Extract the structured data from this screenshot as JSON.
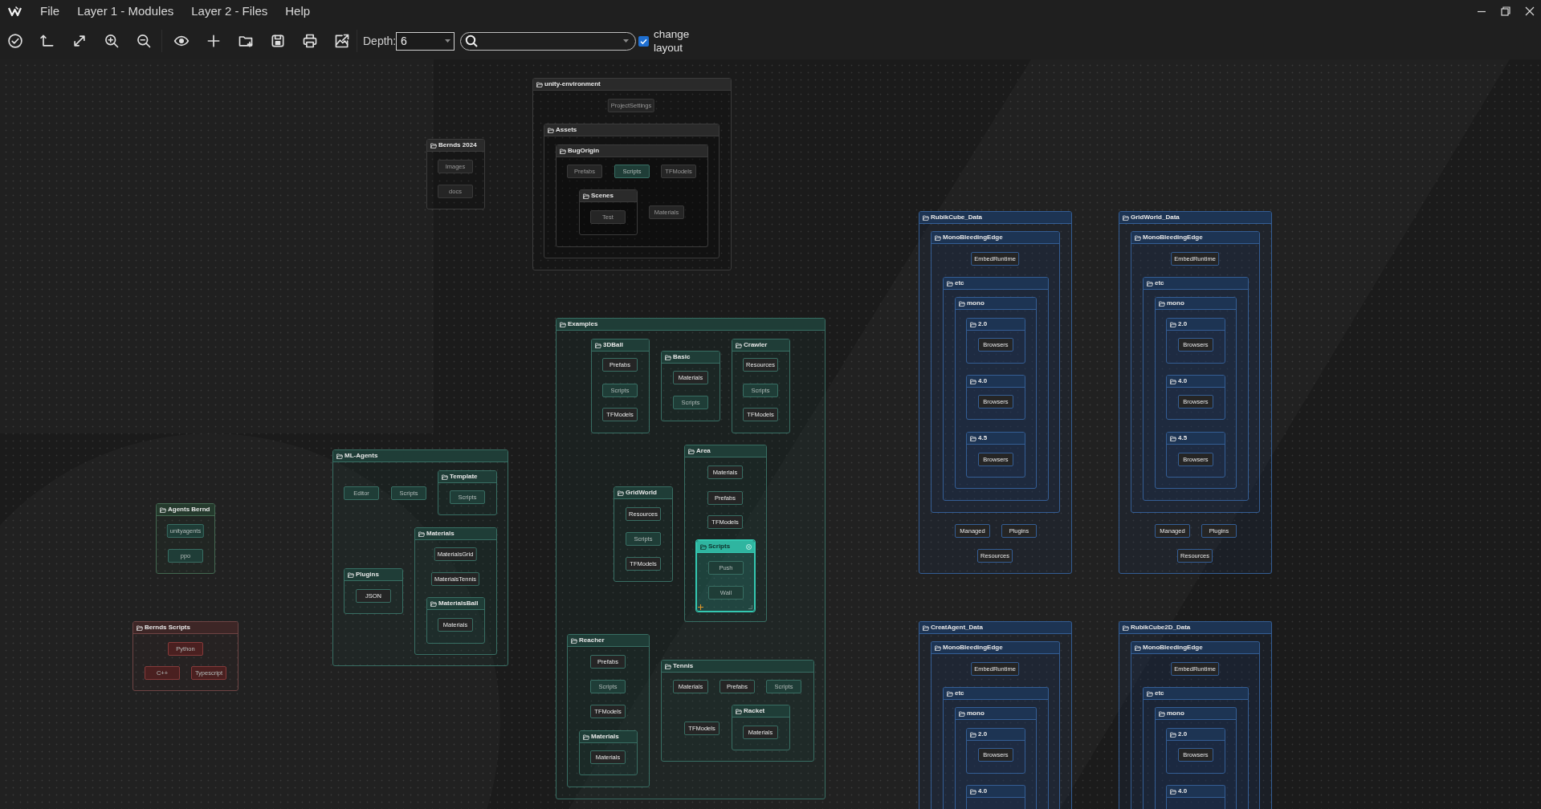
{
  "menu": [
    "File",
    "Layer 1 - Modules",
    "Layer 2 - Files",
    "Help"
  ],
  "toolbar": {
    "depth_label": "Depth:",
    "depth_value": "6",
    "change_layout": {
      "label": "change layout",
      "checked": true
    }
  },
  "diagram": {
    "nodes": [
      {
        "kind": "folder",
        "name": "Bernds 2024",
        "selected": false,
        "children": [
          {
            "kind": "file",
            "name": "Images",
            "selected": false
          },
          {
            "kind": "file",
            "name": "docs",
            "selected": false
          }
        ]
      },
      {
        "kind": "folder",
        "name": "unity-environment",
        "selected": false,
        "children": [
          {
            "kind": "file",
            "name": "ProjectSettings",
            "selected": false
          },
          {
            "kind": "folder",
            "name": "Assets",
            "selected": false,
            "children": [
              {
                "kind": "folder",
                "name": "BugOrigin",
                "selected": false,
                "children": [
                  {
                    "kind": "file",
                    "name": "Prefabs",
                    "selected": false
                  },
                  {
                    "kind": "file",
                    "name": "Scripts",
                    "color": "#1f3d37",
                    "selected": false
                  },
                  {
                    "kind": "file",
                    "name": "TFModels",
                    "selected": false
                  },
                  {
                    "kind": "folder",
                    "name": "Scenes",
                    "selected": false,
                    "children": [
                      {
                        "kind": "file",
                        "name": "Test",
                        "selected": false
                      }
                    ]
                  },
                  {
                    "kind": "file",
                    "name": "Materials",
                    "selected": false
                  }
                ]
              }
            ]
          }
        ]
      },
      {
        "kind": "folder",
        "name": "Agents Bernd",
        "color": "#253a2d",
        "selected": false,
        "children": [
          {
            "kind": "file",
            "name": "unityagents",
            "color": "#1f3d37",
            "selected": false
          },
          {
            "kind": "file",
            "name": "ppo",
            "color": "#1f3d37",
            "selected": false
          }
        ]
      },
      {
        "kind": "folder",
        "name": "Bernds Scripts",
        "color": "#3d2626",
        "selected": false,
        "children": [
          {
            "kind": "file",
            "name": "Python",
            "color": "#4a2020",
            "selected": false
          },
          {
            "kind": "file",
            "name": "C++",
            "color": "#4a2020",
            "selected": false
          },
          {
            "kind": "file",
            "name": "Typescript",
            "color": "#4a2020",
            "selected": false
          }
        ]
      },
      {
        "kind": "folder",
        "name": "ML-Agents",
        "color": "#1f3d37",
        "selected": false,
        "children": [
          {
            "kind": "file",
            "name": "Editor",
            "color": "#1f3d37",
            "selected": false
          },
          {
            "kind": "file",
            "name": "Scripts",
            "color": "#1f3d37",
            "selected": false
          },
          {
            "kind": "folder",
            "name": "Template",
            "color": "#1f3d37",
            "selected": false,
            "children": [
              {
                "kind": "file",
                "name": "Scripts",
                "color": "#1f3d37",
                "selected": false
              }
            ]
          },
          {
            "kind": "folder",
            "name": "Plugins",
            "selected": false,
            "children": [
              {
                "kind": "file",
                "name": "JSON",
                "selected": false
              }
            ]
          },
          {
            "kind": "folder",
            "name": "Materials",
            "selected": false,
            "children": [
              {
                "kind": "file",
                "name": "MaterialsGrid",
                "selected": false
              },
              {
                "kind": "file",
                "name": "MaterialsTennis",
                "selected": false
              },
              {
                "kind": "folder",
                "name": "MaterialsBall",
                "selected": false,
                "children": [
                  {
                    "kind": "file",
                    "name": "Materials",
                    "selected": false
                  }
                ]
              }
            ]
          }
        ]
      },
      {
        "kind": "folder",
        "name": "Examples",
        "color": "#1f3d37",
        "selected": false,
        "children": [
          {
            "kind": "folder",
            "name": "3DBall",
            "selected": false,
            "children": [
              {
                "kind": "file",
                "name": "Prefabs",
                "selected": false
              },
              {
                "kind": "file",
                "name": "Scripts",
                "color": "#1f3d37",
                "selected": false
              },
              {
                "kind": "file",
                "name": "TFModels",
                "selected": false
              }
            ]
          },
          {
            "kind": "folder",
            "name": "Basic",
            "color": "#1f3d37",
            "selected": false,
            "children": [
              {
                "kind": "file",
                "name": "Materials",
                "selected": false
              },
              {
                "kind": "file",
                "name": "Scripts",
                "color": "#1f3d37",
                "selected": false
              }
            ]
          },
          {
            "kind": "folder",
            "name": "Crawler",
            "selected": false,
            "children": [
              {
                "kind": "file",
                "name": "Resources",
                "selected": false
              },
              {
                "kind": "file",
                "name": "Scripts",
                "color": "#1f3d37",
                "selected": false
              },
              {
                "kind": "file",
                "name": "TFModels",
                "selected": false
              }
            ]
          },
          {
            "kind": "folder",
            "name": "GridWorld",
            "selected": false,
            "children": [
              {
                "kind": "file",
                "name": "Resources",
                "selected": false
              },
              {
                "kind": "file",
                "name": "Scripts",
                "color": "#1f3d37",
                "selected": false
              },
              {
                "kind": "file",
                "name": "TFModels",
                "selected": false
              }
            ]
          },
          {
            "kind": "folder",
            "name": "Area",
            "selected": false,
            "children": [
              {
                "kind": "file",
                "name": "Materials",
                "selected": false
              },
              {
                "kind": "file",
                "name": "Prefabs",
                "selected": false
              },
              {
                "kind": "file",
                "name": "TFModels",
                "selected": false
              },
              {
                "kind": "folder",
                "name": "Scripts",
                "color": "#2fb5a0",
                "selected": true,
                "children": [
                  {
                    "kind": "file",
                    "name": "Push",
                    "color": "#1f3d37",
                    "selected": false
                  },
                  {
                    "kind": "file",
                    "name": "Wall",
                    "color": "#1f3d37",
                    "selected": false
                  }
                ]
              }
            ]
          },
          {
            "kind": "folder",
            "name": "Reacher",
            "selected": false,
            "children": [
              {
                "kind": "file",
                "name": "Prefabs",
                "selected": false
              },
              {
                "kind": "file",
                "name": "Scripts",
                "color": "#1f3d37",
                "selected": false
              },
              {
                "kind": "file",
                "name": "TFModels",
                "selected": false
              },
              {
                "kind": "folder",
                "name": "Materials",
                "selected": false,
                "children": [
                  {
                    "kind": "file",
                    "name": "Materials",
                    "selected": false
                  }
                ]
              }
            ]
          },
          {
            "kind": "folder",
            "name": "Tennis",
            "selected": false,
            "children": [
              {
                "kind": "file",
                "name": "Materials",
                "selected": false
              },
              {
                "kind": "file",
                "name": "Prefabs",
                "selected": false
              },
              {
                "kind": "file",
                "name": "Scripts",
                "color": "#1f3d37",
                "selected": false
              },
              {
                "kind": "file",
                "name": "TFModels",
                "selected": false
              },
              {
                "kind": "folder",
                "name": "Racket",
                "selected": false,
                "children": [
                  {
                    "kind": "file",
                    "name": "Materials",
                    "selected": false
                  }
                ]
              }
            ]
          }
        ]
      },
      {
        "kind": "folder",
        "name": "RubikCube_Data",
        "color": "#1d3453",
        "selected": false,
        "children": [
          {
            "kind": "folder",
            "name": "MonoBleedingEdge",
            "color": "#1d3453",
            "selected": false,
            "children": [
              {
                "kind": "file",
                "name": "EmbedRuntime",
                "selected": false
              },
              {
                "kind": "folder",
                "name": "etc",
                "color": "#1d3453",
                "selected": false,
                "children": [
                  {
                    "kind": "folder",
                    "name": "mono",
                    "color": "#1d3453",
                    "selected": false,
                    "children": [
                      {
                        "kind": "folder",
                        "name": "2.0",
                        "color": "#1d3453",
                        "selected": false,
                        "children": [
                          {
                            "kind": "file",
                            "name": "Browsers",
                            "selected": false
                          }
                        ]
                      },
                      {
                        "kind": "folder",
                        "name": "4.0",
                        "color": "#1d3453",
                        "selected": false,
                        "children": [
                          {
                            "kind": "file",
                            "name": "Browsers",
                            "selected": false
                          }
                        ]
                      },
                      {
                        "kind": "folder",
                        "name": "4.5",
                        "color": "#1d3453",
                        "selected": false,
                        "children": [
                          {
                            "kind": "file",
                            "name": "Browsers",
                            "selected": false
                          }
                        ]
                      }
                    ]
                  }
                ]
              }
            ]
          },
          {
            "kind": "file",
            "name": "Managed",
            "selected": false
          },
          {
            "kind": "file",
            "name": "Plugins",
            "selected": false
          },
          {
            "kind": "file",
            "name": "Resources",
            "selected": false
          }
        ]
      },
      {
        "kind": "folder",
        "name": "GridWorld_Data",
        "color": "#1d3453",
        "selected": false,
        "children": [
          {
            "kind": "folder",
            "name": "MonoBleedingEdge",
            "color": "#1d3453",
            "selected": false,
            "children": [
              {
                "kind": "file",
                "name": "EmbedRuntime",
                "selected": false
              },
              {
                "kind": "folder",
                "name": "etc",
                "color": "#1d3453",
                "selected": false,
                "children": [
                  {
                    "kind": "folder",
                    "name": "mono",
                    "color": "#1d3453",
                    "selected": false,
                    "children": [
                      {
                        "kind": "folder",
                        "name": "2.0",
                        "color": "#1d3453",
                        "selected": false,
                        "children": [
                          {
                            "kind": "file",
                            "name": "Browsers",
                            "selected": false
                          }
                        ]
                      },
                      {
                        "kind": "folder",
                        "name": "4.0",
                        "color": "#1d3453",
                        "selected": false,
                        "children": [
                          {
                            "kind": "file",
                            "name": "Browsers",
                            "selected": false
                          }
                        ]
                      },
                      {
                        "kind": "folder",
                        "name": "4.5",
                        "color": "#1d3453",
                        "selected": false,
                        "children": [
                          {
                            "kind": "file",
                            "name": "Browsers",
                            "selected": false
                          }
                        ]
                      }
                    ]
                  }
                ]
              }
            ]
          },
          {
            "kind": "file",
            "name": "Managed",
            "selected": false
          },
          {
            "kind": "file",
            "name": "Plugins",
            "selected": false
          },
          {
            "kind": "file",
            "name": "Resources",
            "selected": false
          }
        ]
      },
      {
        "kind": "folder",
        "name": "CreatAgent_Data",
        "color": "#1d3453",
        "selected": false,
        "children": [
          {
            "kind": "folder",
            "name": "MonoBleedingEdge",
            "color": "#1d3453",
            "selected": false,
            "children": [
              {
                "kind": "file",
                "name": "EmbedRuntime",
                "selected": false
              },
              {
                "kind": "folder",
                "name": "etc",
                "color": "#1d3453",
                "selected": false,
                "children": [
                  {
                    "kind": "folder",
                    "name": "mono",
                    "color": "#1d3453",
                    "selected": false,
                    "children": [
                      {
                        "kind": "folder",
                        "name": "2.0",
                        "color": "#1d3453",
                        "selected": false,
                        "children": [
                          {
                            "kind": "file",
                            "name": "Browsers",
                            "selected": false
                          }
                        ]
                      },
                      {
                        "kind": "folder",
                        "name": "4.0",
                        "color": "#1d3453",
                        "selected": false
                      }
                    ]
                  }
                ]
              }
            ]
          }
        ]
      },
      {
        "kind": "folder",
        "name": "RubikCube2D_Data",
        "color": "#1d3453",
        "selected": false,
        "children": [
          {
            "kind": "folder",
            "name": "MonoBleedingEdge",
            "color": "#1d3453",
            "selected": false,
            "children": [
              {
                "kind": "file",
                "name": "EmbedRuntime",
                "selected": false
              },
              {
                "kind": "folder",
                "name": "etc",
                "color": "#1d3453",
                "selected": false,
                "children": [
                  {
                    "kind": "folder",
                    "name": "mono",
                    "color": "#1d3453",
                    "selected": false,
                    "children": [
                      {
                        "kind": "folder",
                        "name": "2.0",
                        "color": "#1d3453",
                        "selected": false,
                        "children": [
                          {
                            "kind": "file",
                            "name": "Browsers",
                            "selected": false
                          }
                        ]
                      },
                      {
                        "kind": "folder",
                        "name": "4.0",
                        "color": "#1d3453",
                        "selected": false
                      }
                    ]
                  }
                ]
              }
            ]
          }
        ]
      }
    ]
  }
}
